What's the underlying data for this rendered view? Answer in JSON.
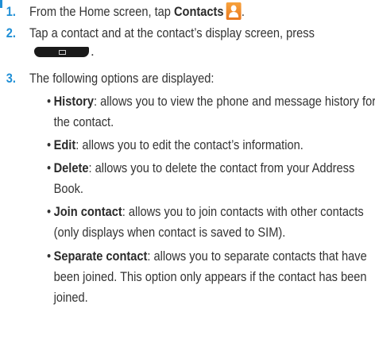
{
  "steps": [
    {
      "number": "1.",
      "before": "From the Home screen, tap ",
      "bold": "Contacts",
      "after": "."
    },
    {
      "number": "2.",
      "line1": "Tap a contact and at the contact’s display screen, press",
      "line2": "."
    },
    {
      "number": "3.",
      "text": "The following options are displayed:"
    }
  ],
  "options": [
    {
      "term": "History",
      "lines": [
        ": allows you to view the phone and message history for",
        "the contact."
      ]
    },
    {
      "term": "Edit",
      "lines": [
        ": allows you to edit the contact’s information."
      ]
    },
    {
      "term": "Delete",
      "lines": [
        ": allows you to delete the contact from your Address",
        "Book."
      ]
    },
    {
      "term": "Join contact",
      "lines": [
        ": allows you to join contacts with other contacts",
        "(only displays when contact is saved to SIM)."
      ]
    },
    {
      "term": "Separate contact",
      "lines": [
        ": allows you to separate contacts that have",
        "been joined. This option only appears if the contact has been",
        "joined."
      ]
    }
  ],
  "icons": {
    "contacts": "contacts-icon",
    "menu": "menu-key-icon"
  },
  "colors": {
    "step_number": "#1f8fd6",
    "text": "#333333",
    "contacts_icon": "#f28c28"
  }
}
